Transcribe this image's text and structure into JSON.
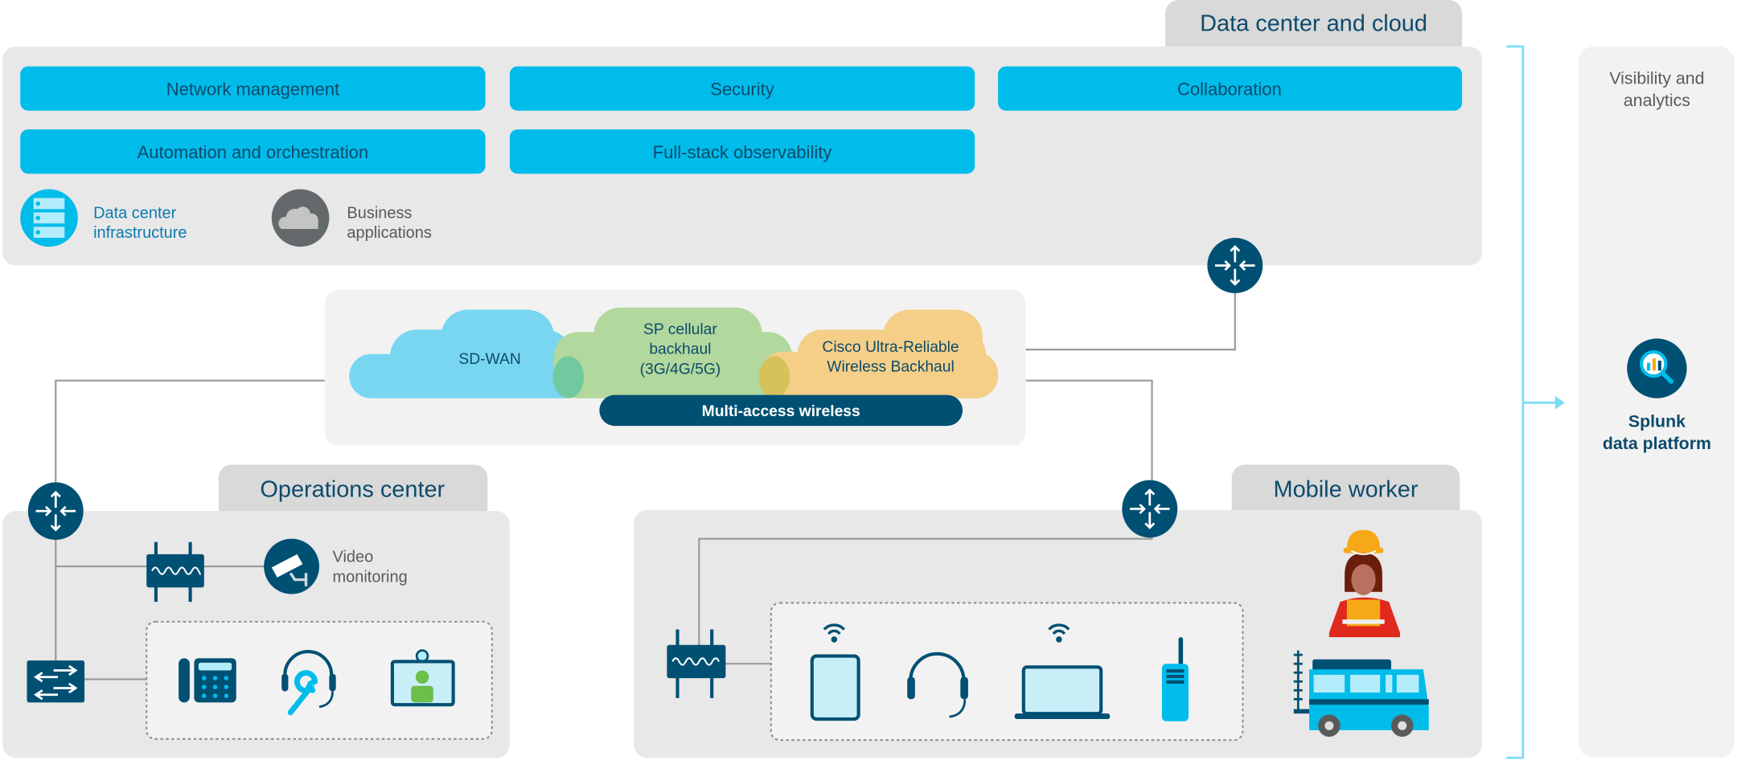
{
  "colors": {
    "accent": "#00bceb",
    "dark_blue": "#005073",
    "panel": "#e8e8e8",
    "tab": "#d9d9d9",
    "inner": "#f2f2f2",
    "sdwan": "#78d6f0",
    "cellular": "#b2d89e",
    "urwb": "#f5cf88"
  },
  "data_center": {
    "tab_label": "Data center and cloud",
    "buttons": [
      {
        "label": "Network management"
      },
      {
        "label": "Security"
      },
      {
        "label": "Collaboration"
      },
      {
        "label": "Automation and orchestration"
      },
      {
        "label": "Full-stack observability"
      }
    ],
    "infra": {
      "line1": "Data center",
      "line2": "infrastructure",
      "icon": "server-rack-icon"
    },
    "business": {
      "line1": "Business",
      "line2": "applications",
      "icon": "cloud-icon"
    }
  },
  "wan": {
    "sdwan": "SD-WAN",
    "cellular": [
      "SP cellular",
      "backhaul",
      "(3G/4G/5G)"
    ],
    "urwb": [
      "Cisco Ultra-Reliable",
      "Wireless Backhaul"
    ],
    "multi_access": "Multi-access wireless"
  },
  "operations": {
    "tab_label": "Operations center",
    "video": {
      "line1": "Video",
      "line2": "monitoring",
      "icon": "security-camera-icon"
    },
    "devices": [
      "ip-phone-icon",
      "headset-support-icon",
      "video-endpoint-icon"
    ]
  },
  "mobile": {
    "tab_label": "Mobile worker",
    "devices": [
      "tablet-icon",
      "headset-icon",
      "laptop-icon",
      "radio-icon"
    ],
    "extras": [
      "worker-icon",
      "vehicle-icon"
    ]
  },
  "analytics": {
    "title_line1": "Visibility and",
    "title_line2": "analytics",
    "product_line1": "Splunk",
    "product_line2": "data platform",
    "icon": "magnifier-chart-icon"
  }
}
